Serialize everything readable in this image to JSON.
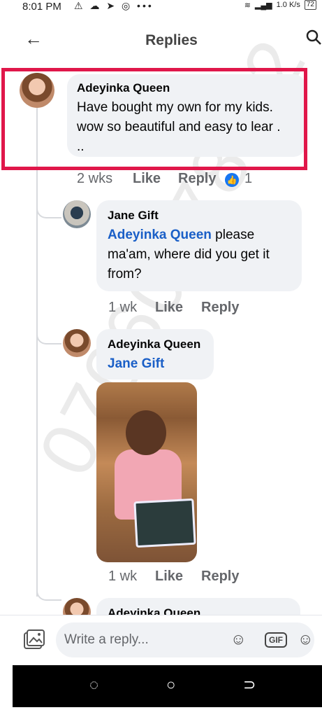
{
  "status": {
    "time": "8:01 PM",
    "speed": "1.0 K/s",
    "battery": "72",
    "icons": "⚠ ☁ ➤ ◎ •••"
  },
  "header": {
    "title": "Replies"
  },
  "comments": [
    {
      "name": "Adeyinka Queen",
      "text": "Have bought my own for my kids. wow so beautiful and easy to lear .",
      "text2": "..",
      "time": "2 wks",
      "like": "Like",
      "reply": "Reply",
      "reactions": "1"
    },
    {
      "name": "Jane Gift",
      "mention": "Adeyinka Queen",
      "text": " please ma'am, where did you get it from?",
      "time": "1 wk",
      "like": "Like",
      "reply": "Reply"
    },
    {
      "name": "Adeyinka Queen",
      "mention": "Jane Gift",
      "time": "1 wk",
      "like": "Like",
      "reply": "Reply"
    },
    {
      "name": "Adeyinka Queen"
    }
  ],
  "watermark": "07060478 62",
  "composer": {
    "placeholder": "Write a reply..."
  },
  "navbar": {
    "recent": "◌",
    "home": "○",
    "back": "⊃"
  },
  "colors": {
    "highlight": "#e0174a",
    "mention": "#1a5fc7",
    "like": "#1877f2"
  }
}
